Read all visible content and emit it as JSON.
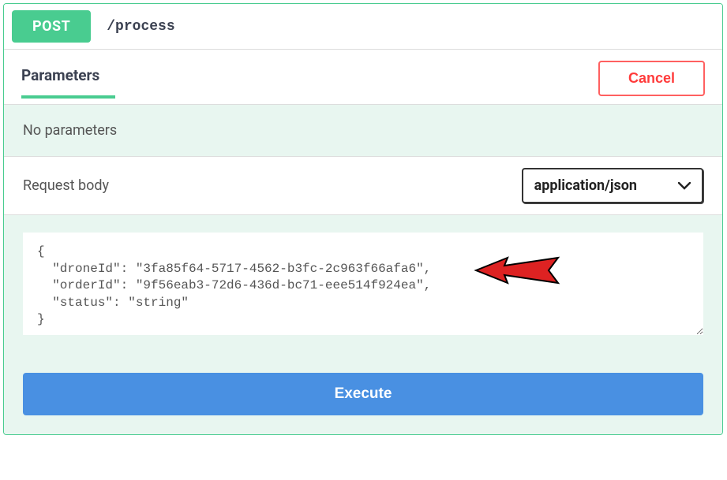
{
  "header": {
    "method": "POST",
    "path": "/process"
  },
  "tabs": {
    "parameters": "Parameters"
  },
  "buttons": {
    "cancel": "Cancel",
    "execute": "Execute"
  },
  "sections": {
    "no_params": "No parameters",
    "request_body": "Request body"
  },
  "content_type": {
    "selected": "application/json"
  },
  "request_body_value": "{\n  \"droneId\": \"3fa85f64-5717-4562-b3fc-2c963f66afa6\",\n  \"orderId\": \"9f56eab3-72d6-436d-bc71-eee514f924ea\",\n  \"status\": \"string\"\n}"
}
